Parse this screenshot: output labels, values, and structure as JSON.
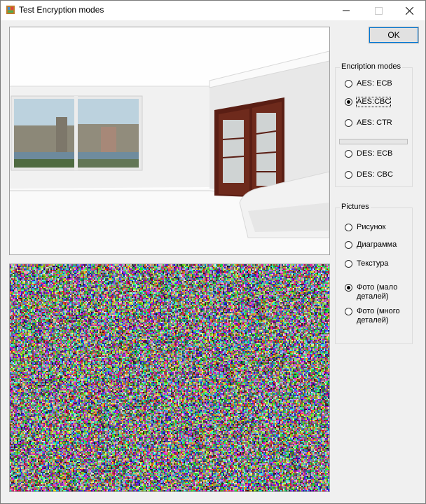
{
  "window": {
    "title": "Test Encryption modes"
  },
  "ok_label": "OK",
  "modes": {
    "legend": "Encription modes",
    "items": [
      "AES: ECB",
      "AES:CBC",
      "AES: CTR",
      "DES: ECB",
      "DES: CBC"
    ],
    "selected": "AES:CBC",
    "progress": 0
  },
  "pictures": {
    "legend": "Pictures",
    "items": [
      "Рисунок",
      "Диаграмма",
      "Текстура",
      "Фото (мало деталей)",
      "Фото (много деталей)"
    ],
    "selected": "Фото (мало деталей)"
  }
}
